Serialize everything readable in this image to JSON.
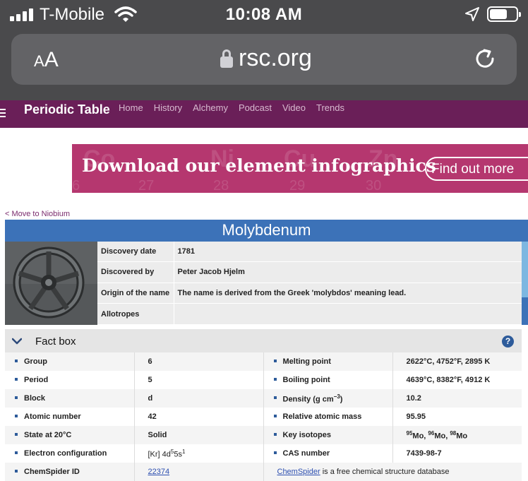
{
  "status_bar": {
    "carrier": "T-Mobile",
    "time": "10:08 AM"
  },
  "address_bar": {
    "text_size_label": "AA",
    "url": "rsc.org"
  },
  "site_nav": {
    "brand": "Periodic Table",
    "links": [
      "Home",
      "History",
      "Alchemy",
      "Podcast",
      "Video",
      "Trends"
    ]
  },
  "banner": {
    "headline": "Download our element infographics",
    "button": "Find out more"
  },
  "back_link": "< Move to Niobium",
  "element": {
    "name": "Molybdenum",
    "info": [
      {
        "label": "Discovery date",
        "value": "1781"
      },
      {
        "label": "Discovered by",
        "value": "Peter Jacob Hjelm"
      },
      {
        "label": "Origin of the name",
        "value": "The name is derived from the Greek 'molybdos' meaning lead."
      },
      {
        "label": "Allotropes",
        "value": ""
      }
    ]
  },
  "fact_box": {
    "title": "Fact box",
    "rows": [
      {
        "l1": "Group",
        "v1": "6",
        "l2": "Melting point",
        "v2": "2622°C, 4752°F, 2895 K"
      },
      {
        "l1": "Period",
        "v1": "5",
        "l2": "Boiling point",
        "v2": "4639°C, 8382°F, 4912 K"
      },
      {
        "l1": "Block",
        "v1": "d",
        "l2": "Density (g cm",
        "l2_sup": "−3",
        "l2_tail": ")",
        "v2": "10.2"
      },
      {
        "l1": "Atomic number",
        "v1": "42",
        "l2": "Relative atomic mass",
        "v2": "95.95"
      },
      {
        "l1": "State at 20°C",
        "v1": "Solid",
        "l2": "Key isotopes",
        "iso": [
          [
            "95",
            "Mo, "
          ],
          [
            "96",
            "Mo, "
          ],
          [
            "98",
            "Mo"
          ]
        ]
      },
      {
        "l1": "Electron configuration",
        "ec_a": "[Kr] 4d",
        "ec_s1": "5",
        "ec_b": "5s",
        "ec_s2": "1",
        "l2": "CAS number",
        "v2": "7439-98-7"
      },
      {
        "l1": "ChemSpider ID",
        "v1": "22374",
        "link": "ChemSpider",
        "link_tail": " is a free chemical structure database"
      }
    ]
  },
  "icons": {
    "chevron": "chevron-down-icon",
    "help": "help-icon"
  },
  "colors": {
    "nav": "#6a1f58",
    "banner": "#b5376f",
    "title_bar": "#3c72b8"
  }
}
